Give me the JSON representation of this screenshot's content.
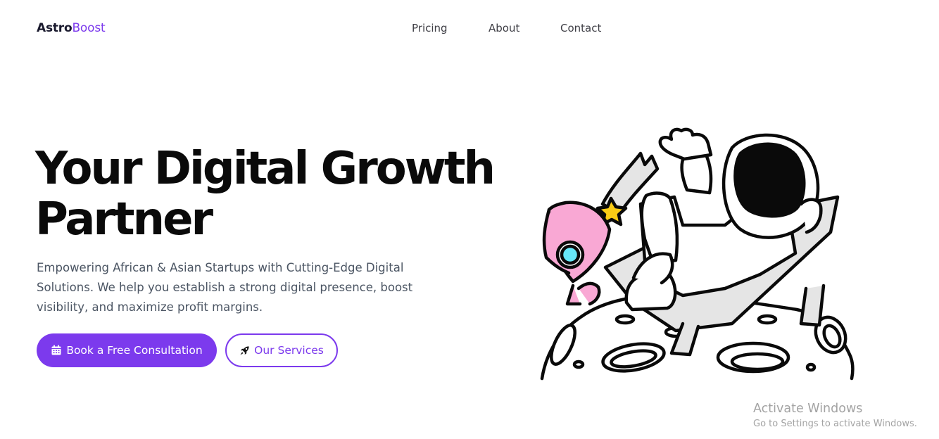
{
  "nav": {
    "logo_part1": "Astro",
    "logo_part2": "Boost",
    "links": [
      "Pricing",
      "About",
      "Contact"
    ]
  },
  "hero": {
    "title": "Your Digital Growth Partner",
    "subtitle": "Empowering African & Asian Startups with Cutting-Edge Digital Solutions. We help you establish a strong digital presence, boost visibility, and maximize profit margins.",
    "primary_button": "Book a Free Consultation",
    "secondary_button": "Our Services"
  },
  "icons": {
    "primary_button_icon": "calendar-icon",
    "secondary_button_icon": "rocket-icon",
    "illustration": "astronaut-illustration"
  },
  "colors": {
    "accent": "#7c3aed",
    "text_dark": "#0a0a0a",
    "text_muted": "#4b5563"
  },
  "watermark": {
    "title": "Activate Windows",
    "subtitle": "Go to Settings to activate Windows."
  }
}
